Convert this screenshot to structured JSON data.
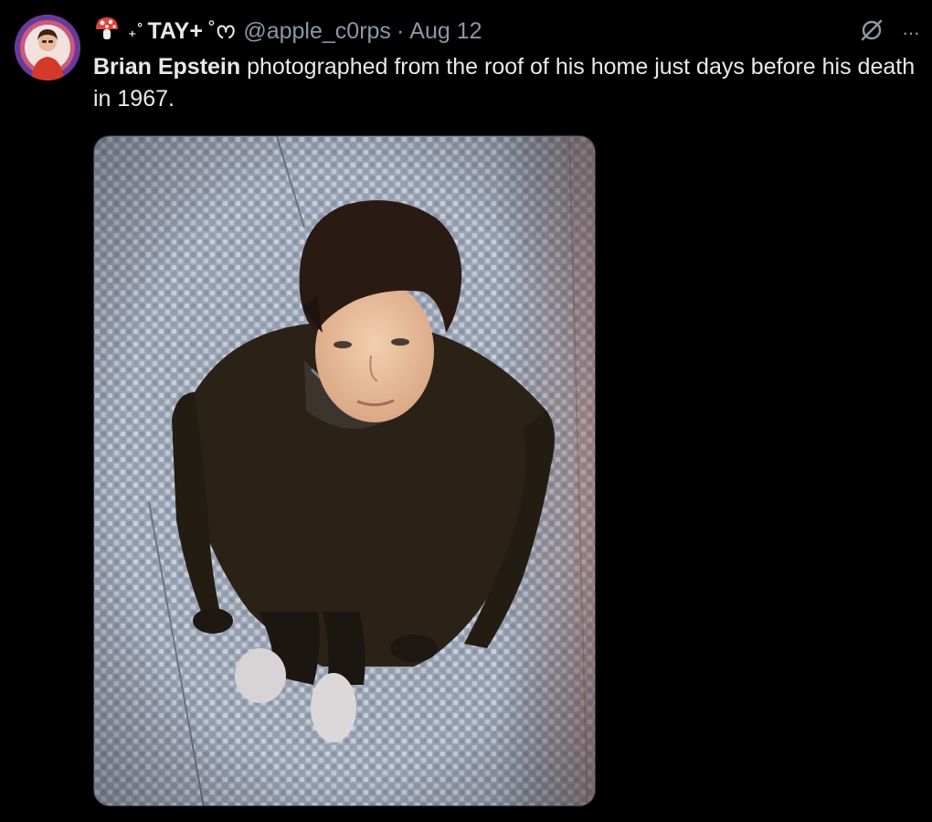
{
  "author": {
    "display_name_prefix": "🍄 ₊˚",
    "display_name": "TAY+",
    "display_name_suffix": "˚ᰔ",
    "handle": "@apple_c0rps",
    "separator": "·",
    "date": "Aug 12"
  },
  "post": {
    "bold_text": "Brian Epstein",
    "text": " photographed from the roof of his home just days before his death in 1967."
  },
  "icons": {
    "grok": "slashed-circle-icon",
    "more": "more-icon",
    "more_glyph": "···"
  },
  "colors": {
    "background": "#000000",
    "text": "#e7e9ea",
    "secondary": "#8b98a5"
  }
}
